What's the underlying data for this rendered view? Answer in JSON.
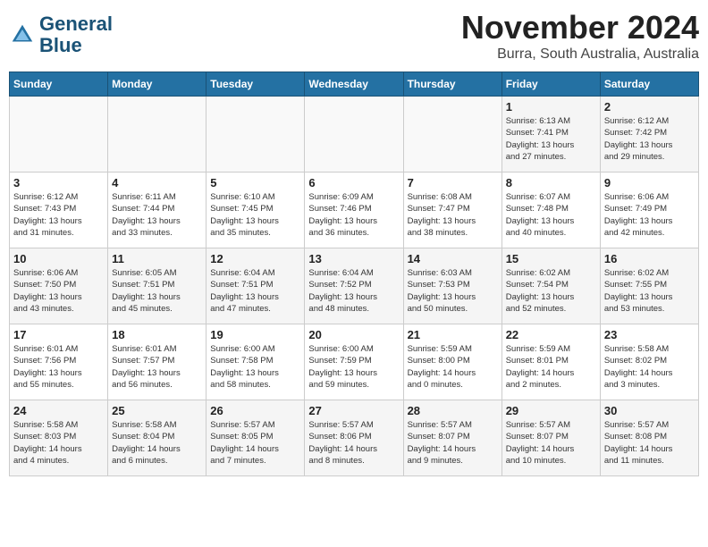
{
  "header": {
    "logo_line1": "General",
    "logo_line2": "Blue",
    "month": "November 2024",
    "location": "Burra, South Australia, Australia"
  },
  "weekdays": [
    "Sunday",
    "Monday",
    "Tuesday",
    "Wednesday",
    "Thursday",
    "Friday",
    "Saturday"
  ],
  "weeks": [
    [
      {
        "day": "",
        "info": ""
      },
      {
        "day": "",
        "info": ""
      },
      {
        "day": "",
        "info": ""
      },
      {
        "day": "",
        "info": ""
      },
      {
        "day": "",
        "info": ""
      },
      {
        "day": "1",
        "info": "Sunrise: 6:13 AM\nSunset: 7:41 PM\nDaylight: 13 hours\nand 27 minutes."
      },
      {
        "day": "2",
        "info": "Sunrise: 6:12 AM\nSunset: 7:42 PM\nDaylight: 13 hours\nand 29 minutes."
      }
    ],
    [
      {
        "day": "3",
        "info": "Sunrise: 6:12 AM\nSunset: 7:43 PM\nDaylight: 13 hours\nand 31 minutes."
      },
      {
        "day": "4",
        "info": "Sunrise: 6:11 AM\nSunset: 7:44 PM\nDaylight: 13 hours\nand 33 minutes."
      },
      {
        "day": "5",
        "info": "Sunrise: 6:10 AM\nSunset: 7:45 PM\nDaylight: 13 hours\nand 35 minutes."
      },
      {
        "day": "6",
        "info": "Sunrise: 6:09 AM\nSunset: 7:46 PM\nDaylight: 13 hours\nand 36 minutes."
      },
      {
        "day": "7",
        "info": "Sunrise: 6:08 AM\nSunset: 7:47 PM\nDaylight: 13 hours\nand 38 minutes."
      },
      {
        "day": "8",
        "info": "Sunrise: 6:07 AM\nSunset: 7:48 PM\nDaylight: 13 hours\nand 40 minutes."
      },
      {
        "day": "9",
        "info": "Sunrise: 6:06 AM\nSunset: 7:49 PM\nDaylight: 13 hours\nand 42 minutes."
      }
    ],
    [
      {
        "day": "10",
        "info": "Sunrise: 6:06 AM\nSunset: 7:50 PM\nDaylight: 13 hours\nand 43 minutes."
      },
      {
        "day": "11",
        "info": "Sunrise: 6:05 AM\nSunset: 7:51 PM\nDaylight: 13 hours\nand 45 minutes."
      },
      {
        "day": "12",
        "info": "Sunrise: 6:04 AM\nSunset: 7:51 PM\nDaylight: 13 hours\nand 47 minutes."
      },
      {
        "day": "13",
        "info": "Sunrise: 6:04 AM\nSunset: 7:52 PM\nDaylight: 13 hours\nand 48 minutes."
      },
      {
        "day": "14",
        "info": "Sunrise: 6:03 AM\nSunset: 7:53 PM\nDaylight: 13 hours\nand 50 minutes."
      },
      {
        "day": "15",
        "info": "Sunrise: 6:02 AM\nSunset: 7:54 PM\nDaylight: 13 hours\nand 52 minutes."
      },
      {
        "day": "16",
        "info": "Sunrise: 6:02 AM\nSunset: 7:55 PM\nDaylight: 13 hours\nand 53 minutes."
      }
    ],
    [
      {
        "day": "17",
        "info": "Sunrise: 6:01 AM\nSunset: 7:56 PM\nDaylight: 13 hours\nand 55 minutes."
      },
      {
        "day": "18",
        "info": "Sunrise: 6:01 AM\nSunset: 7:57 PM\nDaylight: 13 hours\nand 56 minutes."
      },
      {
        "day": "19",
        "info": "Sunrise: 6:00 AM\nSunset: 7:58 PM\nDaylight: 13 hours\nand 58 minutes."
      },
      {
        "day": "20",
        "info": "Sunrise: 6:00 AM\nSunset: 7:59 PM\nDaylight: 13 hours\nand 59 minutes."
      },
      {
        "day": "21",
        "info": "Sunrise: 5:59 AM\nSunset: 8:00 PM\nDaylight: 14 hours\nand 0 minutes."
      },
      {
        "day": "22",
        "info": "Sunrise: 5:59 AM\nSunset: 8:01 PM\nDaylight: 14 hours\nand 2 minutes."
      },
      {
        "day": "23",
        "info": "Sunrise: 5:58 AM\nSunset: 8:02 PM\nDaylight: 14 hours\nand 3 minutes."
      }
    ],
    [
      {
        "day": "24",
        "info": "Sunrise: 5:58 AM\nSunset: 8:03 PM\nDaylight: 14 hours\nand 4 minutes."
      },
      {
        "day": "25",
        "info": "Sunrise: 5:58 AM\nSunset: 8:04 PM\nDaylight: 14 hours\nand 6 minutes."
      },
      {
        "day": "26",
        "info": "Sunrise: 5:57 AM\nSunset: 8:05 PM\nDaylight: 14 hours\nand 7 minutes."
      },
      {
        "day": "27",
        "info": "Sunrise: 5:57 AM\nSunset: 8:06 PM\nDaylight: 14 hours\nand 8 minutes."
      },
      {
        "day": "28",
        "info": "Sunrise: 5:57 AM\nSunset: 8:07 PM\nDaylight: 14 hours\nand 9 minutes."
      },
      {
        "day": "29",
        "info": "Sunrise: 5:57 AM\nSunset: 8:07 PM\nDaylight: 14 hours\nand 10 minutes."
      },
      {
        "day": "30",
        "info": "Sunrise: 5:57 AM\nSunset: 8:08 PM\nDaylight: 14 hours\nand 11 minutes."
      }
    ]
  ]
}
